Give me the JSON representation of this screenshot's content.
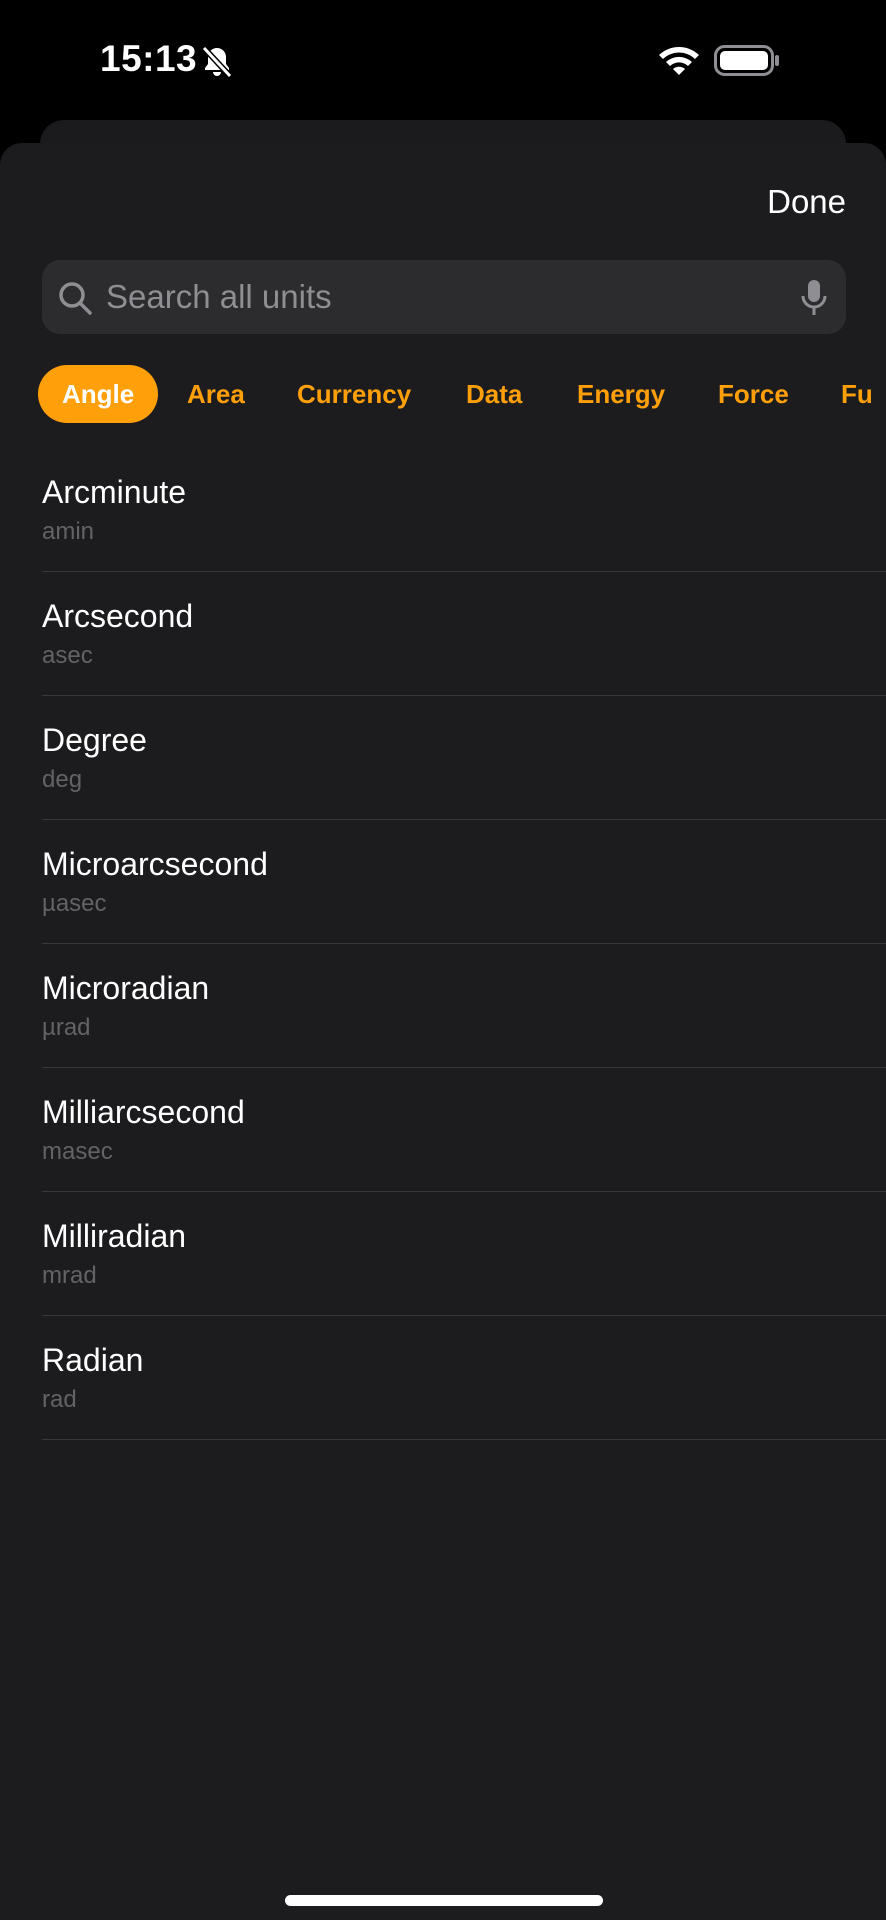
{
  "status_bar": {
    "time": "15:13",
    "icons": [
      "bell-slash-icon",
      "wifi-icon",
      "battery-icon"
    ]
  },
  "header": {
    "done_label": "Done"
  },
  "search": {
    "placeholder": "Search all units",
    "value": "",
    "icons": [
      "search-icon",
      "microphone-icon"
    ]
  },
  "categories": [
    {
      "label": "Angle",
      "active": true
    },
    {
      "label": "Area",
      "active": false
    },
    {
      "label": "Currency",
      "active": false
    },
    {
      "label": "Data",
      "active": false
    },
    {
      "label": "Energy",
      "active": false
    },
    {
      "label": "Force",
      "active": false
    },
    {
      "label": "Fu",
      "active": false
    }
  ],
  "units": [
    {
      "name": "Arcminute",
      "abbr": "amin"
    },
    {
      "name": "Arcsecond",
      "abbr": "asec"
    },
    {
      "name": "Degree",
      "abbr": "deg"
    },
    {
      "name": "Microarcsecond",
      "abbr": "µasec"
    },
    {
      "name": "Microradian",
      "abbr": "µrad"
    },
    {
      "name": "Milliarcsecond",
      "abbr": "masec"
    },
    {
      "name": "Milliradian",
      "abbr": "mrad"
    },
    {
      "name": "Radian",
      "abbr": "rad"
    }
  ],
  "colors": {
    "accent": "#ff9f0a",
    "sheet_background": "#1c1c1e",
    "search_background": "#2c2c2e",
    "secondary_text": "#636366"
  }
}
